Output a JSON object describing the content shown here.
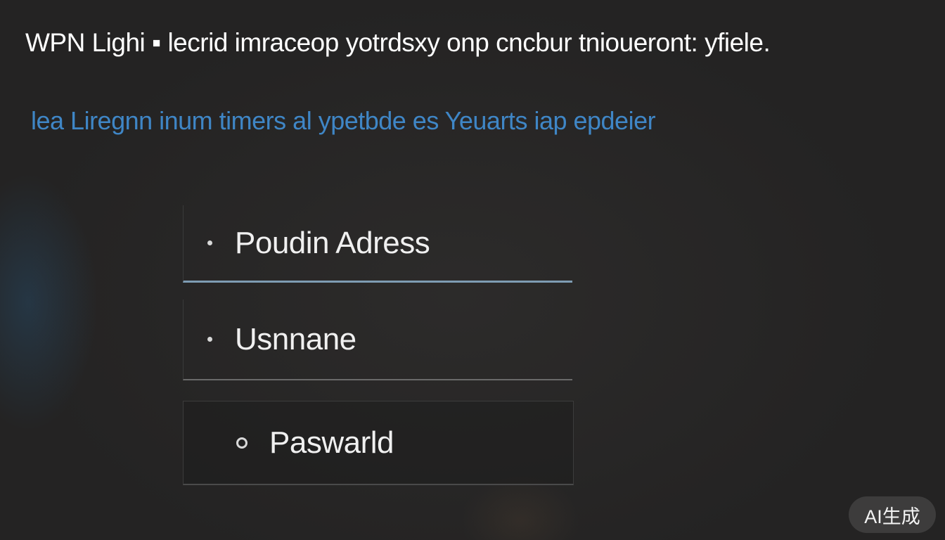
{
  "header": {
    "title": "WPN Lighi ▪ lecrid imraceop yotrdsxy onp cncbur tnioueront: yfiele.",
    "subtitle": "lea Liregnn inum timers al ypetbde es Yeuarts iap epdeier"
  },
  "form": {
    "fields": [
      {
        "label": "Poudin Adress",
        "marker": "bullet",
        "state": "active"
      },
      {
        "label": "Usnnane",
        "marker": "bullet",
        "state": "default"
      },
      {
        "label": "Paswarld",
        "marker": "ring",
        "state": "default"
      }
    ]
  },
  "badge": {
    "label": "AI生成"
  },
  "colors": {
    "background": "#242323",
    "subtitle": "#3f86c6",
    "active_underline": "#7e9cb3",
    "text": "#f0f0f0"
  }
}
